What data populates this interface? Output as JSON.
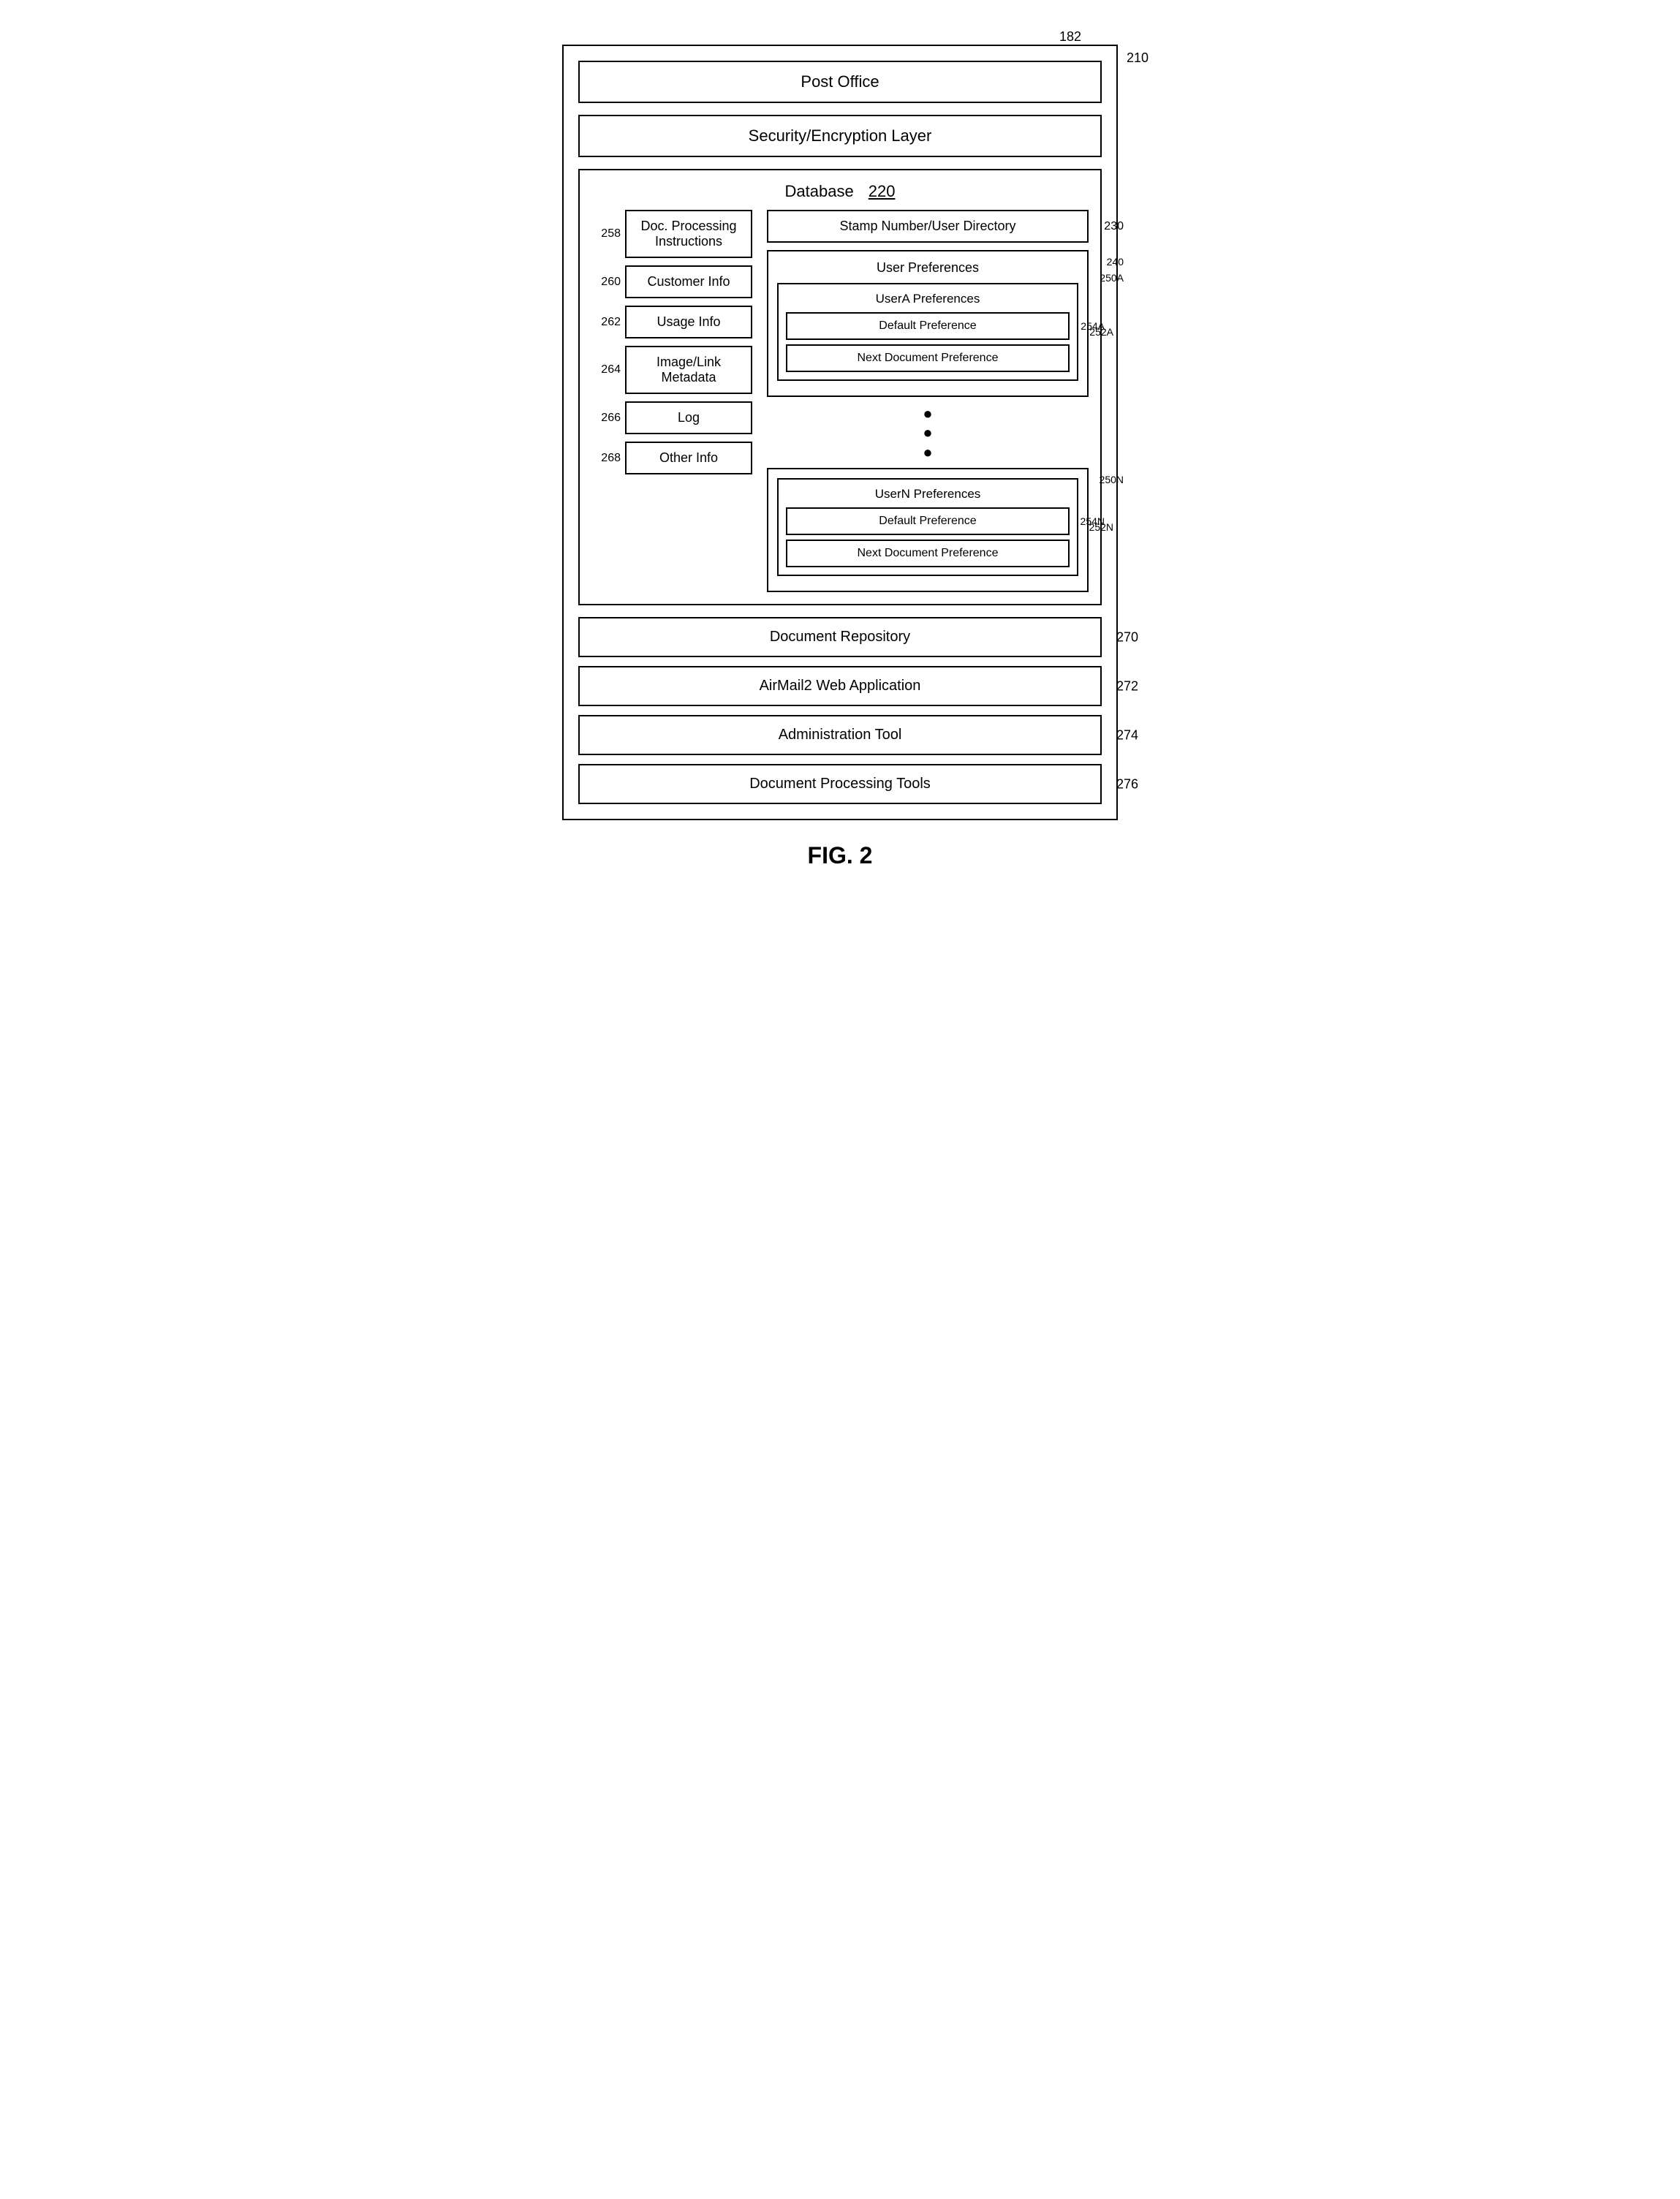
{
  "refs": {
    "r182": "182",
    "r210": "210",
    "r220": "220",
    "r230": "230",
    "r240": "240",
    "r250A": "250A",
    "r252A": "252A",
    "r254A": "254A",
    "r250N": "250N",
    "r252N": "252N",
    "r254N": "254N",
    "r258": "258",
    "r260": "260",
    "r262": "262",
    "r264": "264",
    "r266": "266",
    "r268": "268",
    "r270": "270",
    "r272": "272",
    "r274": "274",
    "r276": "276"
  },
  "labels": {
    "postOffice": "Post Office",
    "security": "Security/Encryption Layer",
    "database": "Database",
    "stampNumber": "Stamp Number/User Directory",
    "userPreferences": "User Preferences",
    "userAPreferences": "UserA Preferences",
    "defaultPreferenceA": "Default Preference",
    "nextDocPreferenceA": "Next Document Preference",
    "userNPreferences": "UserN Preferences",
    "defaultPreferenceN": "Default Preference",
    "nextDocPreferenceN": "Next Document Preference",
    "docProcessing": "Doc. Processing Instructions",
    "customerInfo": "Customer Info",
    "usageInfo": "Usage Info",
    "imageLinkMetadata": "Image/Link Metadata",
    "log": "Log",
    "otherInfo": "Other Info",
    "documentRepository": "Document Repository",
    "airmail2": "AirMail2 Web Application",
    "adminTool": "Administration Tool",
    "docProcessingTools": "Document Processing Tools",
    "figLabel": "FIG. 2"
  }
}
